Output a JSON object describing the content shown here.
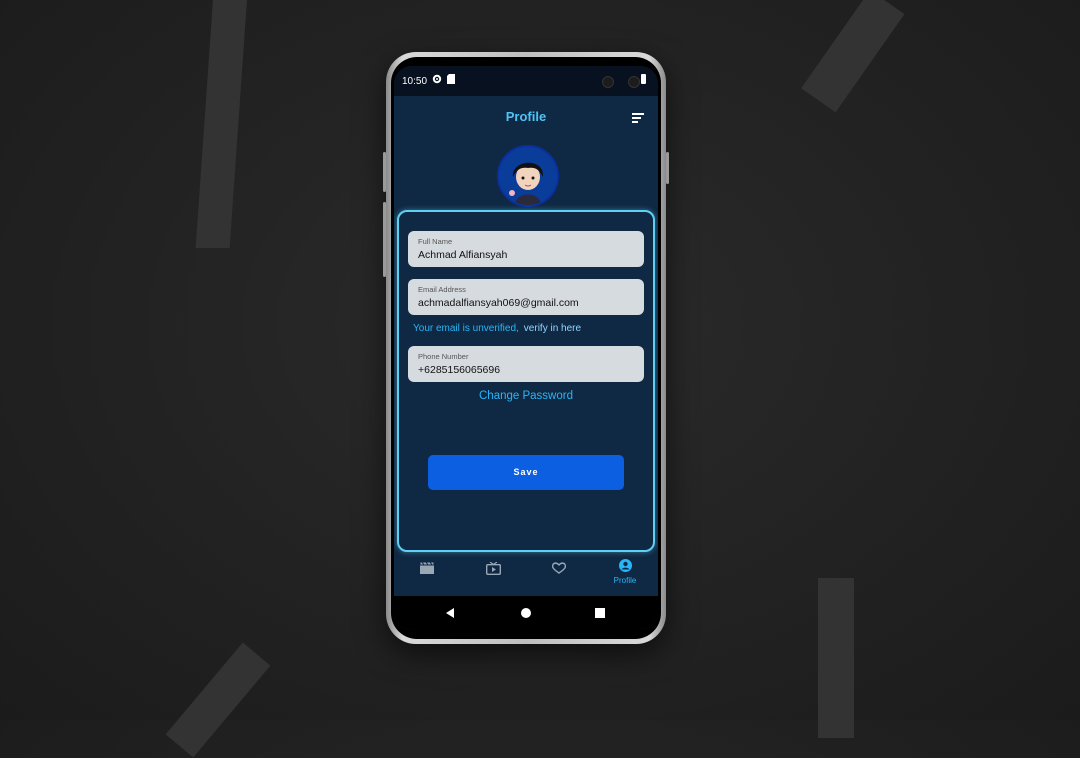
{
  "status_bar": {
    "time": "10:50",
    "icons": [
      "gear-icon",
      "sd-card-icon"
    ]
  },
  "app_bar": {
    "title": "Profile",
    "action_icon": "sort-icon"
  },
  "profile": {
    "full_name_label": "Full Name",
    "full_name": "Achmad Alfiansyah",
    "email_label": "Email Address",
    "email": "achmadalfiansyah069@gmail.com",
    "unverified_text": "Your email is unverified,",
    "verify_link": "verify in here",
    "phone_label": "Phone Number",
    "phone_prefix": "+62",
    "phone": "85156065696",
    "change_password": "Change Password",
    "save_label": "Save"
  },
  "bottom_nav": {
    "items": [
      {
        "icon": "clapperboard-icon",
        "label": ""
      },
      {
        "icon": "tv-play-icon",
        "label": ""
      },
      {
        "icon": "heart-icon",
        "label": ""
      },
      {
        "icon": "account-circle-icon",
        "label": "Profile",
        "active": true
      }
    ]
  },
  "colors": {
    "screen_bg": "#0f2843",
    "accent": "#4fc3f7",
    "button": "#0b5fe0",
    "field_bg": "#d6dbe0"
  }
}
